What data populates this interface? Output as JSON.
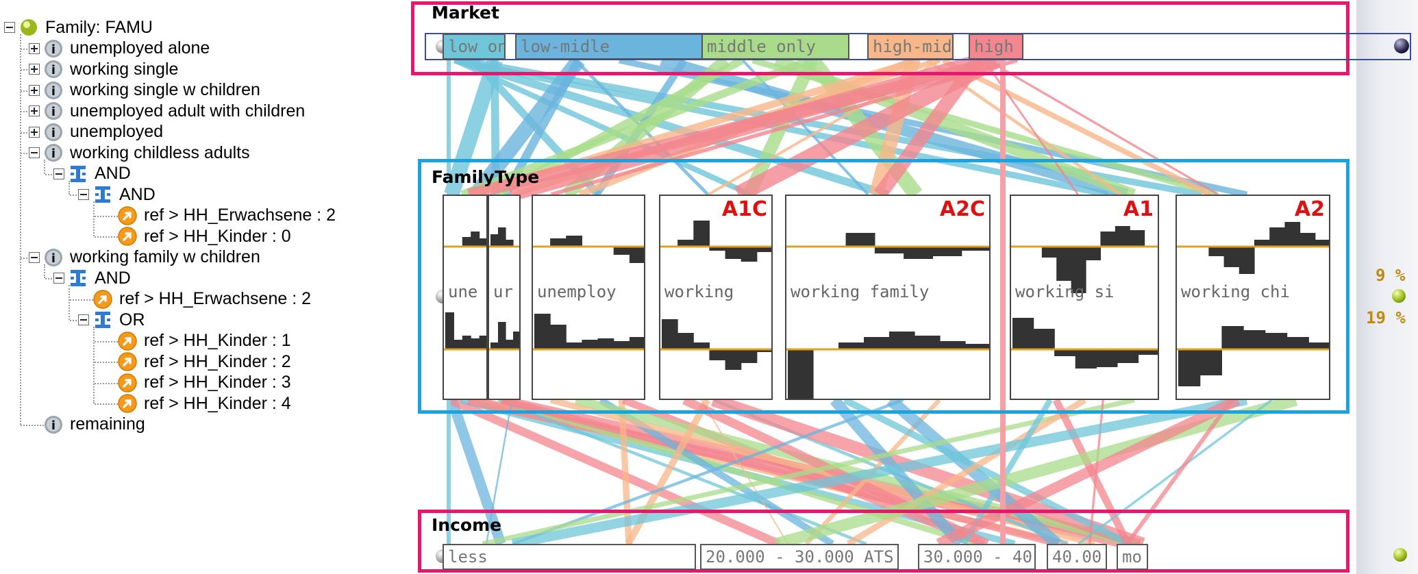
{
  "tree": {
    "root_label": "Family: FAMU",
    "nodes": [
      {
        "label": "unemployed alone",
        "icon": "info-icon"
      },
      {
        "label": "working single",
        "icon": "info-icon"
      },
      {
        "label": "working single w children",
        "icon": "info-icon"
      },
      {
        "label": "unemployed adult with children",
        "icon": "info-icon"
      },
      {
        "label": "unemployed",
        "icon": "info-icon"
      },
      {
        "label": "working childless adults",
        "icon": "info-icon"
      },
      {
        "label": "AND",
        "icon": "logic-and-icon"
      },
      {
        "label": "AND",
        "icon": "logic-and-icon"
      },
      {
        "label": "ref > HH_Erwachsene : 2",
        "icon": "reference-arrow-icon"
      },
      {
        "label": "ref > HH_Kinder : 0",
        "icon": "reference-arrow-icon"
      },
      {
        "label": "working family w children",
        "icon": "info-icon"
      },
      {
        "label": "AND",
        "icon": "logic-and-icon"
      },
      {
        "label": "ref > HH_Erwachsene : 2",
        "icon": "reference-arrow-icon"
      },
      {
        "label": "OR",
        "icon": "logic-or-icon"
      },
      {
        "label": "ref > HH_Kinder : 1",
        "icon": "reference-arrow-icon"
      },
      {
        "label": "ref > HH_Kinder : 2",
        "icon": "reference-arrow-icon"
      },
      {
        "label": "ref > HH_Kinder : 3",
        "icon": "reference-arrow-icon"
      },
      {
        "label": "ref > HH_Kinder : 4",
        "icon": "reference-arrow-icon"
      },
      {
        "label": "remaining",
        "icon": "info-icon"
      }
    ]
  },
  "market": {
    "title": "Market",
    "categories": [
      {
        "label": "low on",
        "color": "#6fc6d9"
      },
      {
        "label": "low-midle",
        "color": "#6bb4dd"
      },
      {
        "label": "middle only",
        "color": "#a8dc8a"
      },
      {
        "label": "high-mid",
        "color": "#f7b789"
      },
      {
        "label": "high",
        "color": "#f3868e"
      }
    ]
  },
  "familytype": {
    "title": "FamilyType",
    "panels": [
      {
        "label": "une",
        "tag": ""
      },
      {
        "label": "ur",
        "tag": ""
      },
      {
        "label": "unemploy",
        "tag": ""
      },
      {
        "label": "working",
        "tag": "A1C"
      },
      {
        "label": "working family",
        "tag": "A2C"
      },
      {
        "label": "working si",
        "tag": "A1"
      },
      {
        "label": "working chi",
        "tag": "A2"
      }
    ]
  },
  "income": {
    "title": "Income",
    "categories": [
      {
        "label": "less"
      },
      {
        "label": "20.000 - 30.000 ATS"
      },
      {
        "label": "30.000 - 40"
      },
      {
        "label": "40.00"
      },
      {
        "label": "mo"
      }
    ]
  },
  "side_indicator": {
    "top_percent": "9 %",
    "bottom_percent": "19 %"
  },
  "colors": {
    "market_frame": "#e5186e",
    "familytype_frame": "#1aa3dc",
    "income_frame": "#e5186e",
    "histogram_fill": "#333333",
    "baseline": "#e0a020"
  }
}
